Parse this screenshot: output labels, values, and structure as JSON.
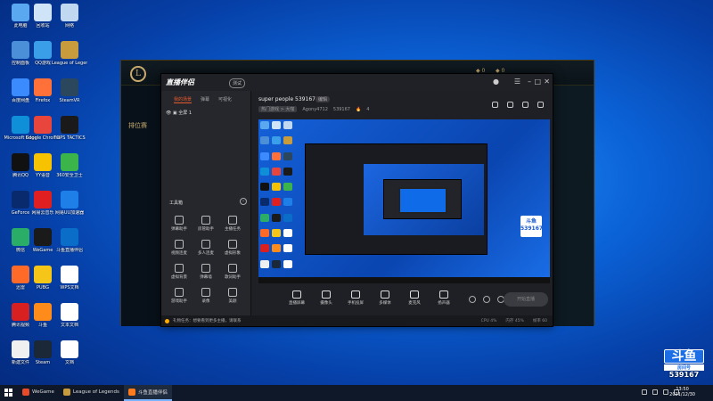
{
  "desktop": {
    "icons": [
      {
        "label": "此电脑",
        "color": "#5aa8f0"
      },
      {
        "label": "回收站",
        "color": "#d0e4f8"
      },
      {
        "label": "网络",
        "color": "#c0d8f0"
      },
      {
        "label": "控制面板",
        "color": "#4b8fd8"
      },
      {
        "label": "QQ游戏",
        "color": "#3a9ee8"
      },
      {
        "label": "League of Legends",
        "color": "#c89b3c"
      },
      {
        "label": "百度网盘",
        "color": "#3b8bff"
      },
      {
        "label": "Firefox",
        "color": "#ff7139"
      },
      {
        "label": "SteamVR",
        "color": "#2a475e"
      },
      {
        "label": "Microsoft Edge",
        "color": "#0f8fd8"
      },
      {
        "label": "Google Chrome",
        "color": "#e8453c"
      },
      {
        "label": "TOPS TACTICS",
        "color": "#1a1a1a"
      },
      {
        "label": "腾讯QQ",
        "color": "#111111"
      },
      {
        "label": "YY语音",
        "color": "#f7c300"
      },
      {
        "label": "360安全卫士",
        "color": "#3bb54a"
      },
      {
        "label": "GeForce",
        "color": "#0a2a6e"
      },
      {
        "label": "网易云音乐",
        "color": "#e02020"
      },
      {
        "label": "网易UU加速器",
        "color": "#1e7fe8"
      },
      {
        "label": "微信",
        "color": "#2aae67"
      },
      {
        "label": "WeGame",
        "color": "#1a1a1a"
      },
      {
        "label": "斗鱼直播伴侣",
        "color": "#0a6ec8"
      },
      {
        "label": "迅雷",
        "color": "#ff6a28"
      },
      {
        "label": "PUBG",
        "color": "#f5c518"
      },
      {
        "label": "WPS文档",
        "color": "#ffffff"
      },
      {
        "label": "腾讯视频",
        "color": "#d82020"
      },
      {
        "label": "斗鱼",
        "color": "#ff8c1a"
      },
      {
        "label": "文本文档",
        "color": "#ffffff"
      },
      {
        "label": "新建文件",
        "color": "#f0f0f0"
      },
      {
        "label": "Steam",
        "color": "#1b2838"
      },
      {
        "label": "文档",
        "color": "#ffffff"
      }
    ]
  },
  "lol": {
    "title": "League of Legends",
    "side_text": "排位赛"
  },
  "douyu": {
    "app_name": "直播伴侣",
    "version_badge": "测试",
    "tabs": [
      "我的场景",
      "弹幕",
      "可视化"
    ],
    "scene_label": "全屏 1",
    "tools_title": "工具箱",
    "tools": [
      "弹幕助手",
      "房管助手",
      "主播任务",
      "视频连麦",
      "多人连麦",
      "虚拟形象",
      "虚拟背景",
      "弹幕墙",
      "歌词助手",
      "游戏助手",
      "录像",
      "美颜"
    ],
    "room_title": "super people 539167",
    "room_tag": "编辑",
    "room_category": "热门游戏 > 大咖",
    "room_user": "Agony4712",
    "room_id": "539167",
    "room_hot": "4",
    "controls": [
      "直播屏幕",
      "摄像头",
      "手机投屏",
      "多媒体",
      "麦克风",
      "扬声器"
    ],
    "live_button": "开始直播",
    "status_text": "礼物任务：想要看到更多主播，请联系",
    "status_stats": [
      "CPU 4%",
      "内存 45%",
      "帧率 60"
    ]
  },
  "taskbar": {
    "apps": [
      {
        "label": "WeGame",
        "color": "#e84a2a",
        "active": false
      },
      {
        "label": "League of Legends",
        "color": "#c89b3c",
        "active": false
      },
      {
        "label": "斗鱼直播伴侣",
        "color": "#ff7a1a",
        "active": true
      }
    ],
    "time": "13:50",
    "date": "2021/12/30"
  },
  "watermark": {
    "logo": "斗鱼",
    "label": "房间号",
    "number": "539167"
  }
}
